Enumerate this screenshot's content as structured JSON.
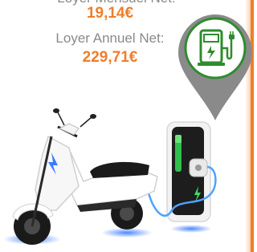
{
  "rent": {
    "monthly_label": "Loyer Mensuel Net:",
    "monthly_value": "19,14€",
    "annual_label": "Loyer Annuel Net:",
    "annual_value": "229,71€"
  },
  "icons": {
    "pin": "charging-station-pin-icon",
    "product": "electric-scooter-with-charger-image"
  },
  "colors": {
    "accent": "#f07d2a",
    "pin_grey": "#8a8a8a",
    "station_green": "#2e8b2e",
    "text_grey": "#8a8a8a"
  }
}
